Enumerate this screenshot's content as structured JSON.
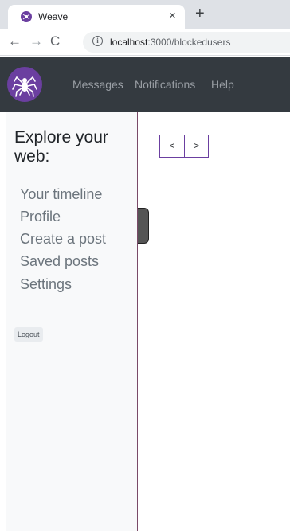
{
  "browser": {
    "tab_title": "Weave",
    "tab_close": "×",
    "new_tab": "+",
    "back": "←",
    "forward": "→",
    "reload": "C",
    "info": "i",
    "url_host": "localhost",
    "url_path": ":3000/blockedusers"
  },
  "navbar": {
    "links": [
      "Messages",
      "Notifications",
      "Help"
    ]
  },
  "sidebar": {
    "heading": "Explore your web:",
    "links": [
      "Your timeline",
      "Profile",
      "Create a post",
      "Saved posts",
      "Settings"
    ],
    "logout": "Logout"
  },
  "pager": {
    "prev": "<",
    "next": ">"
  },
  "colors": {
    "brand": "#6b3fa0",
    "navbar": "#343a40",
    "sidebar": "#f8f9fa"
  }
}
